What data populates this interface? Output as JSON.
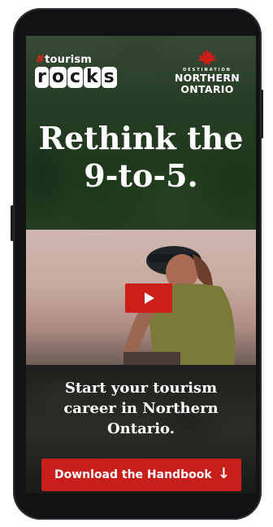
{
  "brand": {
    "hashtag_prefix": "#",
    "hashtag_word": "tourism",
    "logo_letters": [
      "r",
      "o",
      "c",
      "k",
      "s"
    ]
  },
  "partner": {
    "small_text": "DESTINATION",
    "line1": "NORTHERN",
    "line2": "ONTARIO",
    "icon": "maple-leaf-icon"
  },
  "hero": {
    "headline_line1": "Rethink the",
    "headline_line2": "9-to-5."
  },
  "video": {
    "icon": "play-icon"
  },
  "body": {
    "line1": "Start your tourism",
    "line2": "career in Northern",
    "line3": "Ontario."
  },
  "cta": {
    "label": "Download the Handbook",
    "icon": "arrow-down-icon",
    "arrow": "↓"
  },
  "colors": {
    "accent": "#c81f1b",
    "text": "#ffffff"
  }
}
